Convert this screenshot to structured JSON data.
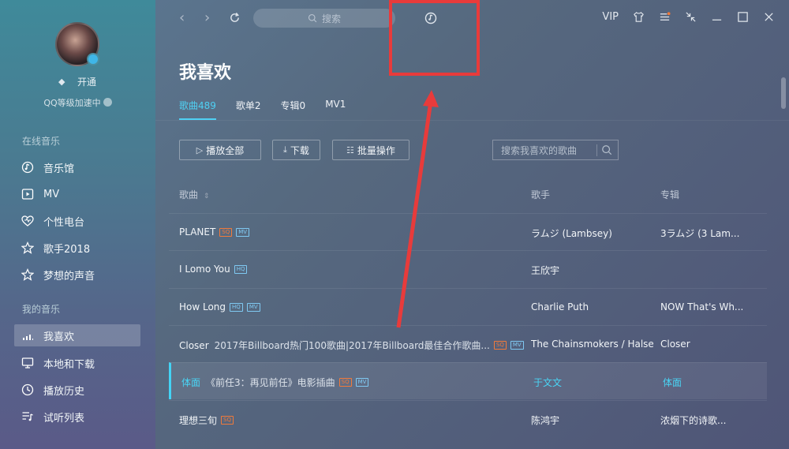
{
  "sidebar": {
    "vip_label": "开通",
    "qq_level": "QQ等级加速中",
    "sections": [
      {
        "title": "在线音乐",
        "items": [
          {
            "label": "音乐馆",
            "icon": "music-hall-icon"
          },
          {
            "label": "MV",
            "icon": "mv-icon"
          },
          {
            "label": "个性电台",
            "icon": "radio-heart-icon"
          },
          {
            "label": "歌手2018",
            "icon": "star-icon"
          },
          {
            "label": "梦想的声音",
            "icon": "star-outline-icon"
          }
        ]
      },
      {
        "title": "我的音乐",
        "items": [
          {
            "label": "我喜欢",
            "icon": "equalizer-icon",
            "active": true
          },
          {
            "label": "本地和下载",
            "icon": "monitor-icon"
          },
          {
            "label": "播放历史",
            "icon": "history-icon"
          },
          {
            "label": "试听列表",
            "icon": "playlist-icon"
          }
        ]
      }
    ]
  },
  "topbar": {
    "search_placeholder": "搜索",
    "vip": "VIP"
  },
  "main": {
    "title": "我喜欢",
    "tabs": [
      {
        "label": "歌曲489",
        "active": true
      },
      {
        "label": "歌单2"
      },
      {
        "label": "专辑0"
      },
      {
        "label": "MV1"
      }
    ],
    "buttons": {
      "play_all": "播放全部",
      "download": "下载",
      "batch": "批量操作"
    },
    "search_placeholder": "搜索我喜欢的歌曲",
    "columns": {
      "song": "歌曲",
      "singer": "歌手",
      "album": "专辑"
    },
    "rows": [
      {
        "song": "PLANET",
        "extra": "",
        "tags": [
          "SQ",
          "MV"
        ],
        "singer": "ラムジ (Lambsey)",
        "album": "3ラムジ (3 Lam..."
      },
      {
        "song": "I Lomo You",
        "extra": "",
        "tags": [
          "HQ"
        ],
        "singer": "王欣宇",
        "album": ""
      },
      {
        "song": "How Long",
        "extra": "",
        "tags": [
          "HQ",
          "MV"
        ],
        "singer": "Charlie Puth",
        "album": "NOW That's Wh..."
      },
      {
        "song": "Closer",
        "extra": "2017年Billboard热门100歌曲|2017年Billboard最佳合作歌曲...",
        "tags": [
          "SQ",
          "MV"
        ],
        "singer": "The Chainsmokers / Halsey",
        "album": "Closer"
      },
      {
        "song": "体面",
        "extra": "《前任3：再见前任》电影插曲",
        "tags": [
          "SQ",
          "MV"
        ],
        "singer": "于文文",
        "album": "体面",
        "active": true
      },
      {
        "song": "理想三旬",
        "extra": "",
        "tags": [
          "SQ"
        ],
        "singer": "陈鸿宇",
        "album": "浓烟下的诗歌..."
      }
    ]
  },
  "colors": {
    "accent": "#43d3f5",
    "annotation_red": "#e83b3b",
    "sq_tag": "#f27a3a",
    "mv_tag": "#7fc9f2"
  }
}
